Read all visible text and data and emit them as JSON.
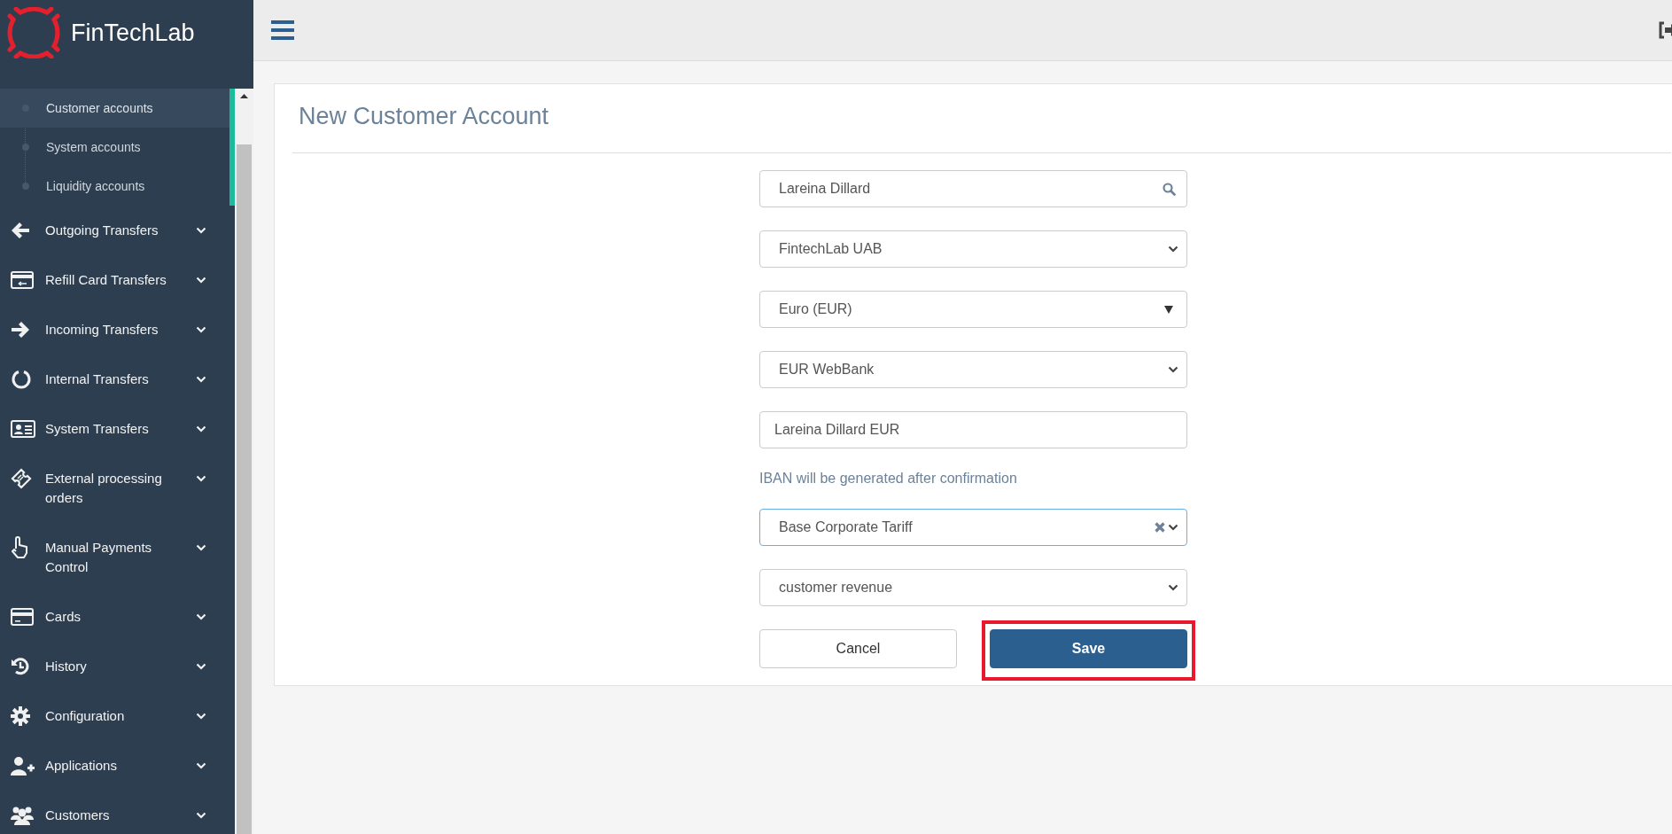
{
  "brand": {
    "name": "FinTechLab"
  },
  "sidebar": {
    "subitems": [
      {
        "label": "Customer accounts",
        "selected": true
      },
      {
        "label": "System accounts",
        "selected": false
      },
      {
        "label": "Liquidity accounts",
        "selected": false
      }
    ],
    "items": [
      {
        "label": "Outgoing Transfers"
      },
      {
        "label": "Refill Card Transfers"
      },
      {
        "label": "Incoming Transfers"
      },
      {
        "label": "Internal Transfers"
      },
      {
        "label": "System Transfers"
      },
      {
        "label": "External processing orders"
      },
      {
        "label": "Manual Payments Control"
      },
      {
        "label": "Cards"
      },
      {
        "label": "History"
      },
      {
        "label": "Configuration"
      },
      {
        "label": "Applications"
      },
      {
        "label": "Customers"
      }
    ]
  },
  "page": {
    "title": "New Customer Account"
  },
  "form": {
    "fields": [
      {
        "kind": "search",
        "value": "Lareina Dillard"
      },
      {
        "kind": "select",
        "value": "FintechLab UAB"
      },
      {
        "kind": "dropdown",
        "value": "Euro (EUR)"
      },
      {
        "kind": "select",
        "value": "EUR WebBank"
      },
      {
        "kind": "text",
        "value": "Lareina Dillard EUR"
      },
      {
        "kind": "note",
        "text": "IBAN will be generated after confirmation"
      },
      {
        "kind": "clearable",
        "value": "Base Corporate Tariff",
        "focused": true
      },
      {
        "kind": "select",
        "value": "customer revenue"
      }
    ],
    "buttons": [
      {
        "label": "Cancel",
        "kind": "secondary",
        "highlighted": false
      },
      {
        "label": "Save",
        "kind": "primary",
        "highlighted": true
      }
    ]
  }
}
